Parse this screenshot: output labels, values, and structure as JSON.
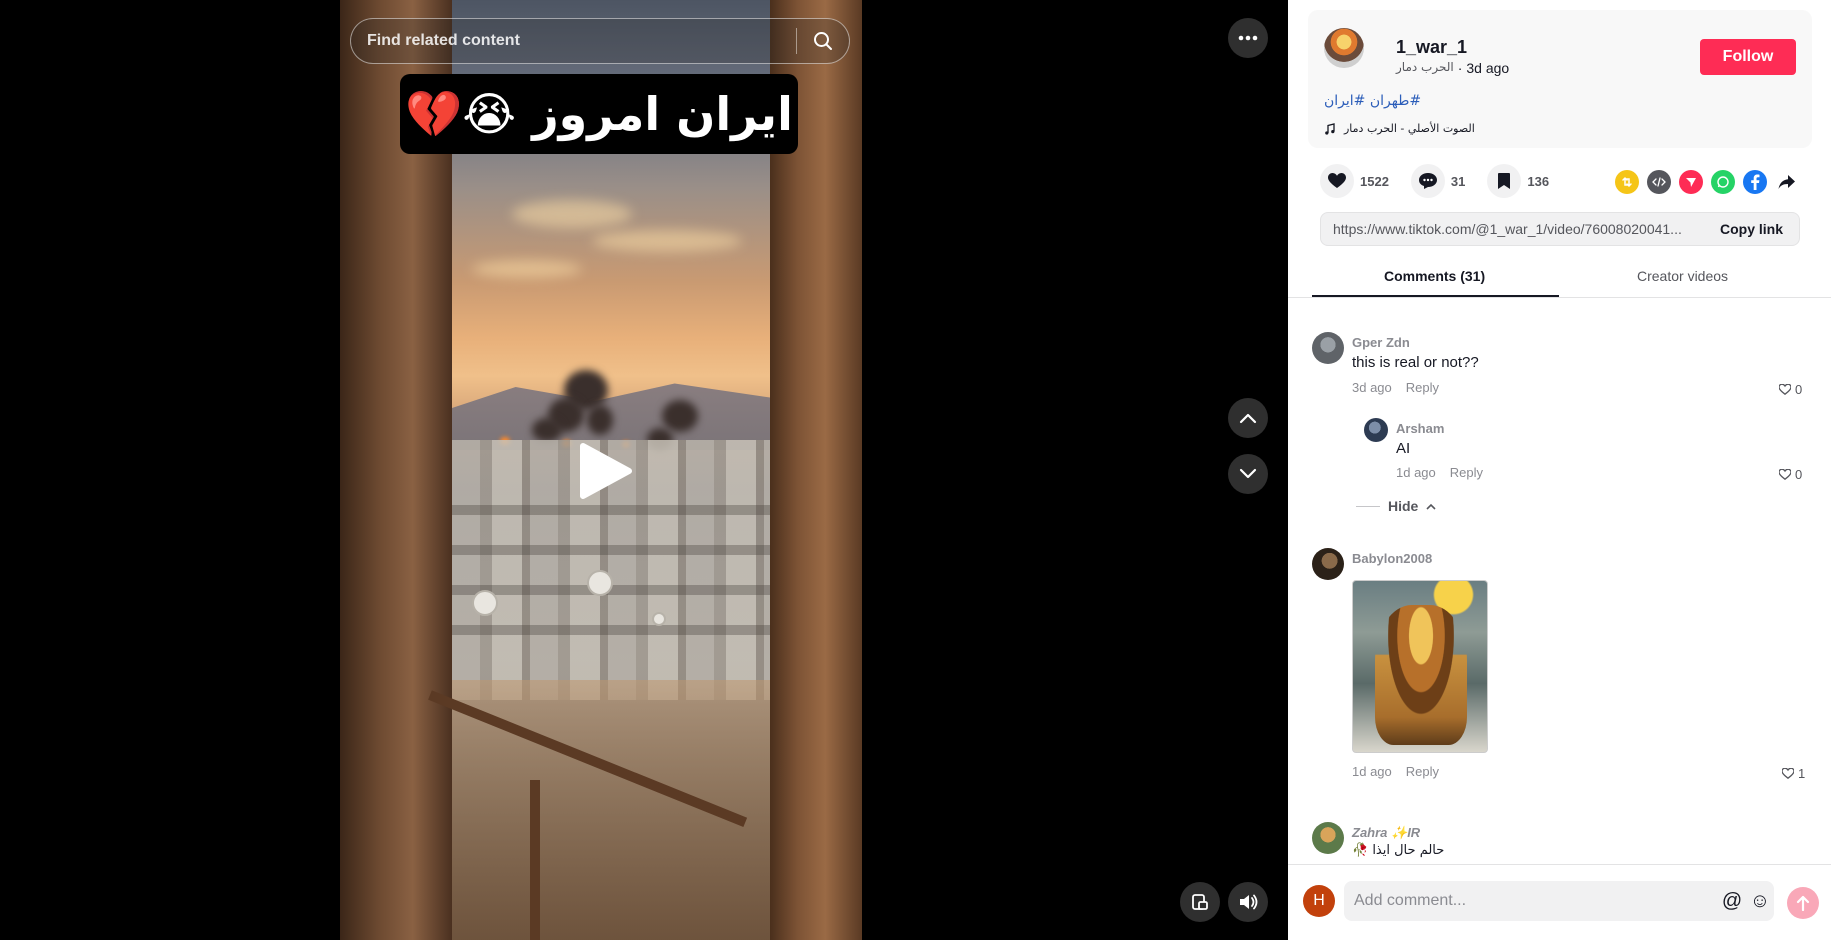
{
  "video": {
    "search_placeholder": "Find related content",
    "caption": "ایران امروز 😭💔"
  },
  "author": {
    "username": "1_war_1",
    "nickname": "الحرب دمار",
    "separator": "·",
    "posted": "3d ago",
    "follow_label": "Follow"
  },
  "post": {
    "hashtags": "#طهران #ایران",
    "music": "الصوت الأصلي - الحرب دمار"
  },
  "stats": {
    "likes": "1522",
    "comments": "31",
    "saves": "136"
  },
  "share_icons": [
    "repost-icon",
    "embed-icon",
    "send-to-friends-icon",
    "whatsapp-icon",
    "facebook-icon",
    "share-arrow-icon"
  ],
  "link": {
    "url": "https://www.tiktok.com/@1_war_1/video/76008020041...",
    "copy_label": "Copy link"
  },
  "tabs": {
    "comments_label": "Comments (31)",
    "creator_label": "Creator videos"
  },
  "comments": [
    {
      "user": "Gper Zdn",
      "text": "this is real or not??",
      "time": "3d ago",
      "reply_label": "Reply",
      "likes": "0"
    },
    {
      "user": "Arsham",
      "text": "AI",
      "time": "1d ago",
      "reply_label": "Reply",
      "likes": "0"
    },
    {
      "user": "Babylon2008",
      "text": "",
      "time": "1d ago",
      "reply_label": "Reply",
      "likes": "1"
    },
    {
      "user": "Zahra ✨IR",
      "text": "حالم حال ایذا 🥀"
    }
  ],
  "hide_label": "Hide",
  "composer": {
    "avatar_letter": "H",
    "placeholder": "Add comment...",
    "mention_icon": "@",
    "emoji_icon": "☺"
  },
  "colors": {
    "follow": "#fe2c55",
    "hashtag": "#2b5db9",
    "post_button": "#f9a8b8"
  }
}
